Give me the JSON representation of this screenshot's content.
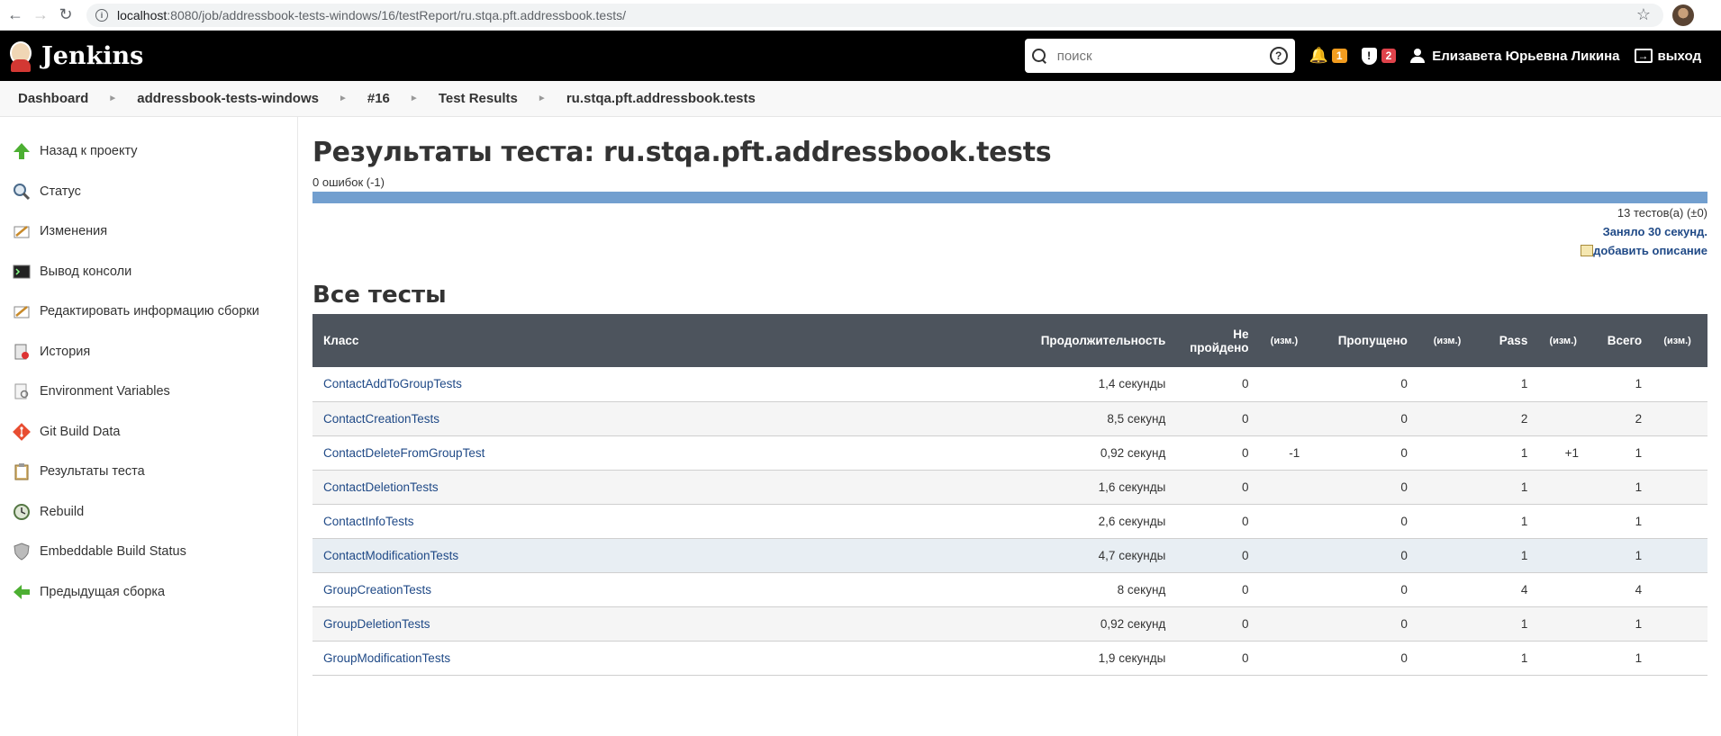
{
  "browser": {
    "url_host": "localhost",
    "url_rest": ":8080/job/addressbook-tests-windows/16/testReport/ru.stqa.pft.addressbook.tests/"
  },
  "header": {
    "title": "Jenkins",
    "search_placeholder": "поиск",
    "notifications_count": "1",
    "security_count": "2",
    "user_name": "Елизавета Юрьевна Ликина",
    "logout_label": "выход",
    "colors": {
      "bar": "#000000",
      "orange_badge": "#f29c1f",
      "red_badge": "#e0434b"
    }
  },
  "breadcrumb": [
    "Dashboard",
    "addressbook-tests-windows",
    "#16",
    "Test Results",
    "ru.stqa.pft.addressbook.tests"
  ],
  "sidebar": {
    "items": [
      {
        "label": "Назад к проекту",
        "icon": "up-arrow-icon"
      },
      {
        "label": "Статус",
        "icon": "magnifier-icon"
      },
      {
        "label": "Изменения",
        "icon": "notepad-icon"
      },
      {
        "label": "Вывод консоли",
        "icon": "terminal-icon"
      },
      {
        "label": "Редактировать информацию сборки",
        "icon": "notepad-icon"
      },
      {
        "label": "История",
        "icon": "history-icon"
      },
      {
        "label": "Environment Variables",
        "icon": "document-magnifier-icon"
      },
      {
        "label": "Git Build Data",
        "icon": "git-icon"
      },
      {
        "label": "Результаты теста",
        "icon": "clipboard-icon"
      },
      {
        "label": "Rebuild",
        "icon": "rebuild-icon"
      },
      {
        "label": "Embeddable Build Status",
        "icon": "shield-icon"
      },
      {
        "label": "Предыдущая сборка",
        "icon": "back-arrow-icon"
      }
    ]
  },
  "main": {
    "title": "Результаты теста: ru.stqa.pft.addressbook.tests",
    "fail_summary": "0 ошибок (-1)",
    "pass_fraction": 1.0,
    "tests_count": "13 тестов(а) (±0)",
    "duration": "Заняло 30 секунд.",
    "add_description": "добавить описание",
    "all_tests_heading": "Все тесты",
    "columns": [
      "Класс",
      "Продолжительность",
      "Не пройдено",
      "(изм.)",
      "Пропущено",
      "(изм.)",
      "Pass",
      "(изм.)",
      "Всего",
      "(изм.)"
    ],
    "rows": [
      [
        "ContactAddToGroupTests",
        "1,4 секунды",
        "0",
        "",
        "0",
        "",
        "1",
        "",
        "1",
        ""
      ],
      [
        "ContactCreationTests",
        "8,5 секунд",
        "0",
        "",
        "0",
        "",
        "2",
        "",
        "2",
        ""
      ],
      [
        "ContactDeleteFromGroupTest",
        "0,92 секунд",
        "0",
        "-1",
        "0",
        "",
        "1",
        "+1",
        "1",
        ""
      ],
      [
        "ContactDeletionTests",
        "1,6 секунды",
        "0",
        "",
        "0",
        "",
        "1",
        "",
        "1",
        ""
      ],
      [
        "ContactInfoTests",
        "2,6 секунды",
        "0",
        "",
        "0",
        "",
        "1",
        "",
        "1",
        ""
      ],
      [
        "ContactModificationTests",
        "4,7 секунды",
        "0",
        "",
        "0",
        "",
        "1",
        "",
        "1",
        ""
      ],
      [
        "GroupCreationTests",
        "8 секунд",
        "0",
        "",
        "0",
        "",
        "4",
        "",
        "4",
        ""
      ],
      [
        "GroupDeletionTests",
        "0,92 секунд",
        "0",
        "",
        "0",
        "",
        "1",
        "",
        "1",
        ""
      ],
      [
        "GroupModificationTests",
        "1,9 секунды",
        "0",
        "",
        "0",
        "",
        "1",
        "",
        "1",
        ""
      ]
    ]
  }
}
